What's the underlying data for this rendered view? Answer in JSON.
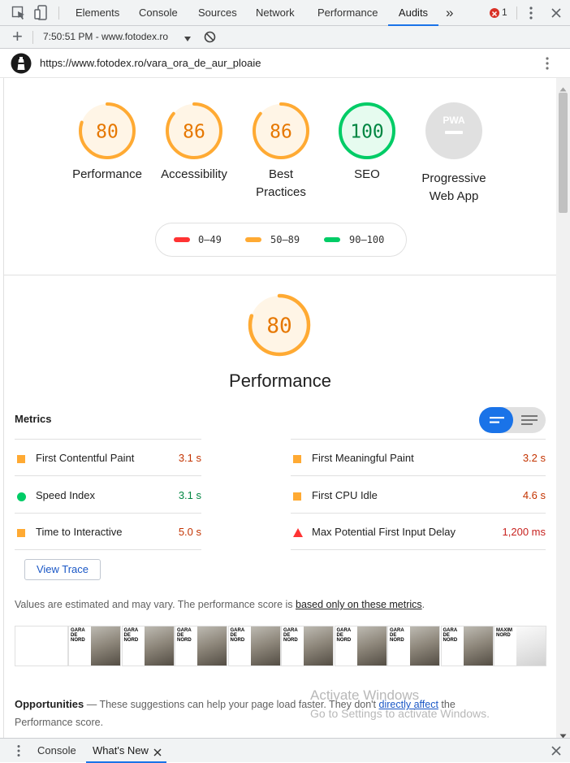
{
  "tabbar": {
    "tabs": [
      {
        "label": "Elements",
        "active": false
      },
      {
        "label": "Console",
        "active": false
      },
      {
        "label": "Sources",
        "active": false
      },
      {
        "label": "Network",
        "active": false
      },
      {
        "label": "Performance",
        "active": false
      },
      {
        "label": "Audits",
        "active": true
      }
    ],
    "more_label": "»",
    "error_count": "1"
  },
  "toolbar": {
    "add_label": "+",
    "report_selector": "7:50:51 PM - www.fotodex.ro"
  },
  "urlbar": {
    "url": "https://www.fotodex.ro/vara_ora_de_aur_ploaie"
  },
  "scores": [
    {
      "value": "80",
      "score": 80,
      "label": "Performance",
      "color": "#fa3"
    },
    {
      "value": "86",
      "score": 86,
      "label": "Accessibility",
      "color": "#fa3"
    },
    {
      "value": "86",
      "score": 86,
      "label": "Best\nPractices",
      "color": "#fa3"
    },
    {
      "value": "100",
      "score": 100,
      "label": "SEO",
      "color": "#0c6"
    },
    {
      "value": "PWA",
      "score": null,
      "label": "Progressive\nWeb App",
      "color": "#bbb"
    }
  ],
  "legend": {
    "fail": {
      "label": "0–49",
      "color": "#f33"
    },
    "average": {
      "label": "50–89",
      "color": "#fa3"
    },
    "pass": {
      "label": "90–100",
      "color": "#0c6"
    }
  },
  "performance": {
    "score_text": "80",
    "score": 80,
    "title": "Performance"
  },
  "metrics": {
    "heading": "Metrics",
    "left": [
      {
        "name": "First Contentful Paint",
        "value": "3.1 s",
        "status": "average"
      },
      {
        "name": "Speed Index",
        "value": "3.1 s",
        "status": "pass"
      },
      {
        "name": "Time to Interactive",
        "value": "5.0 s",
        "status": "average"
      }
    ],
    "right": [
      {
        "name": "First Meaningful Paint",
        "value": "3.2 s",
        "status": "average"
      },
      {
        "name": "First CPU Idle",
        "value": "4.6 s",
        "status": "average"
      },
      {
        "name": "Max Potential First Input Delay",
        "value": "1,200 ms",
        "status": "fail"
      }
    ]
  },
  "view_trace_label": "View Trace",
  "estimate_note": {
    "text": "Values are estimated and may vary. The performance score is ",
    "link": "based only on these metrics",
    "end": "."
  },
  "filmstrip": {
    "thumb_text": "GARA\nDE\nNORD",
    "last_text": "MAXIM\nNORD"
  },
  "opportunities": {
    "heading": "Opportunities",
    "dash": "—",
    "text": "These suggestions can help your page load faster. They don't ",
    "link": "directly affect",
    "text_after": " the",
    "line2": "Performance score."
  },
  "watermark": {
    "title": "Activate Windows",
    "subtitle": "Go to Settings to activate Windows."
  },
  "drawer": {
    "tabs": [
      {
        "label": "Console",
        "active": false
      },
      {
        "label": "What's New",
        "active": true
      }
    ]
  }
}
